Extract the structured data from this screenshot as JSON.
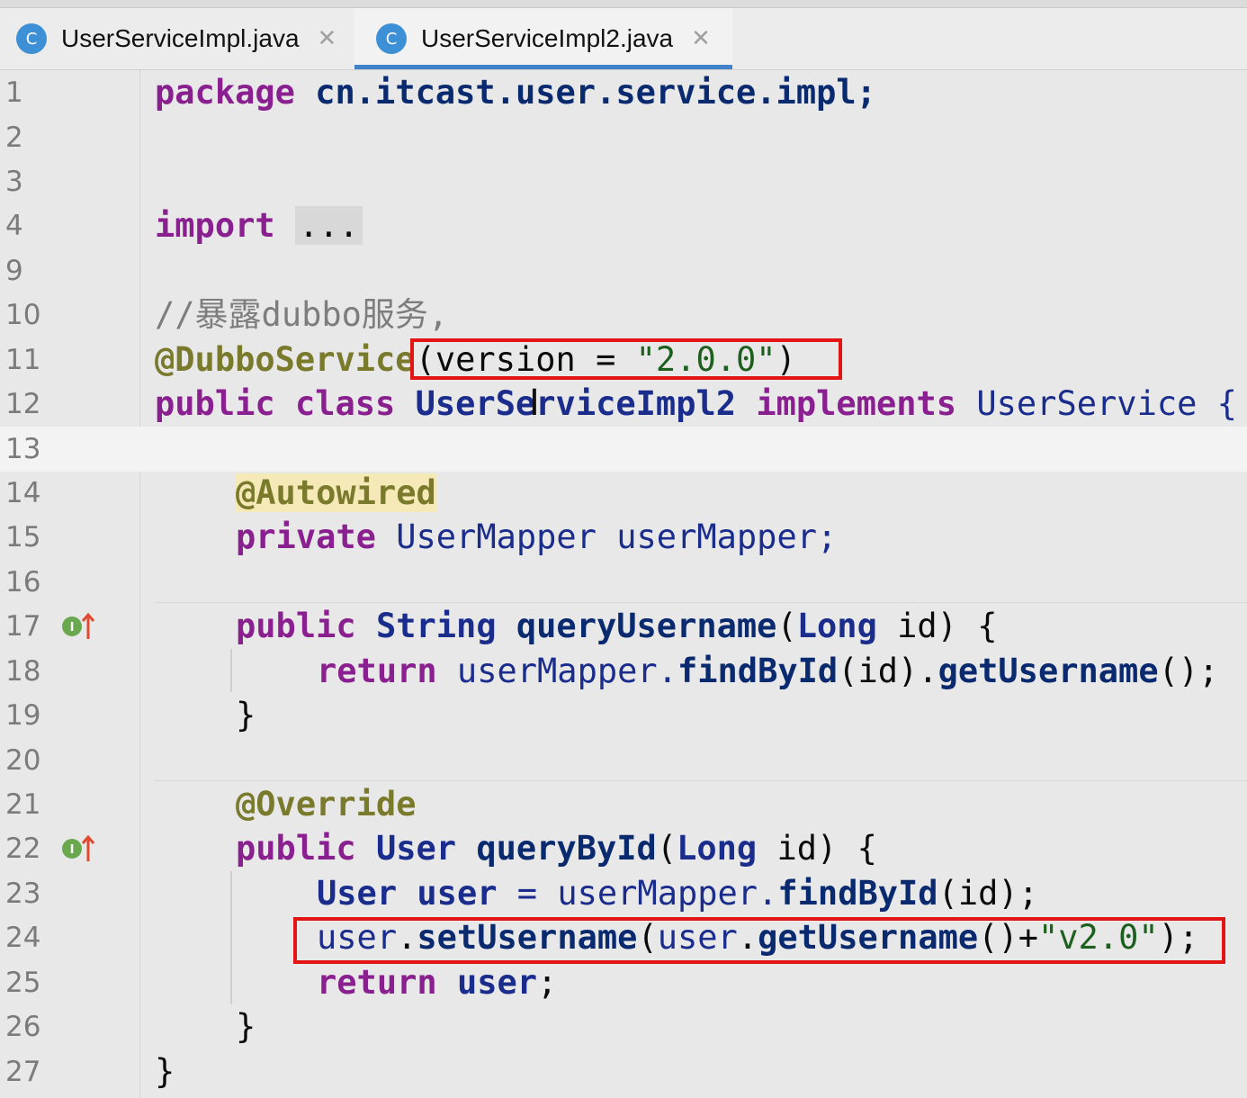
{
  "tabs": [
    {
      "label": "UserServiceImpl.java",
      "icon": "C",
      "active": false
    },
    {
      "label": "UserServiceImpl2.java",
      "icon": "C",
      "active": true
    }
  ],
  "lines": {
    "n1": "1",
    "n2": "2",
    "n3": "3",
    "n4": "4",
    "n9": "9",
    "n10": "10",
    "n11": "11",
    "n12": "12",
    "n13": "13",
    "n14": "14",
    "n15": "15",
    "n16": "16",
    "n17": "17",
    "n18": "18",
    "n19": "19",
    "n20": "20",
    "n21": "21",
    "n22": "22",
    "n23": "23",
    "n24": "24",
    "n25": "25",
    "n26": "26",
    "n27": "27"
  },
  "code": {
    "l1_kw": "package",
    "l1_rest": " cn.itcast.user.service.impl;",
    "l4_kw": "import",
    "l4_fold": "...",
    "l10_comment": "//暴露dubbo服务,",
    "l11_ann": "@DubboService",
    "l11_open": "(version = ",
    "l11_str": "\"2.0.0\"",
    "l11_close": ")",
    "l12_kw1": "public",
    "l12_kw2": "class",
    "l12_cls": "UserServiceImpl2",
    "l12_kw3": "implements",
    "l12_iface": "UserService {",
    "l14_ann": "@Autowired",
    "l15_kw": "private",
    "l15_rest": " UserMapper userMapper;",
    "l17_kw": "public",
    "l17_type": "String",
    "l17_fn": "queryUsername",
    "l17_p1": "(",
    "l17_ptype": "Long",
    "l17_p2": " id) {",
    "l18_kw": "return",
    "l18_a": " userMapper.",
    "l18_fn1": "findById",
    "l18_b": "(id).",
    "l18_fn2": "getUsername",
    "l18_c": "();",
    "l19": "}",
    "l21_ann": "@Override",
    "l22_kw": "public",
    "l22_type": "User",
    "l22_fn": "queryById",
    "l22_p1": "(",
    "l22_ptype": "Long",
    "l22_p2": " id) {",
    "l23_type": "User",
    "l23_var": "user",
    "l23_a": " = userMapper.",
    "l23_fn": "findById",
    "l23_b": "(id);",
    "l24_var": "user",
    "l24_a": ".",
    "l24_fn1": "setUsername",
    "l24_b": "(",
    "l24_var2": "user",
    "l24_c": ".",
    "l24_fn2": "getUsername",
    "l24_d": "()+",
    "l24_str": "\"v2.0\"",
    "l24_e": ");",
    "l25_kw": "return",
    "l25_var": "user",
    "l25_semi": ";",
    "l26": "}",
    "l27": "}"
  },
  "gutter_icons": [
    "implements-interface-icon",
    "implements-interface-icon"
  ],
  "colors": {
    "highlight_box": "#e31414",
    "tab_underline": "#4083c9",
    "class_icon": "#3d8fd6"
  }
}
